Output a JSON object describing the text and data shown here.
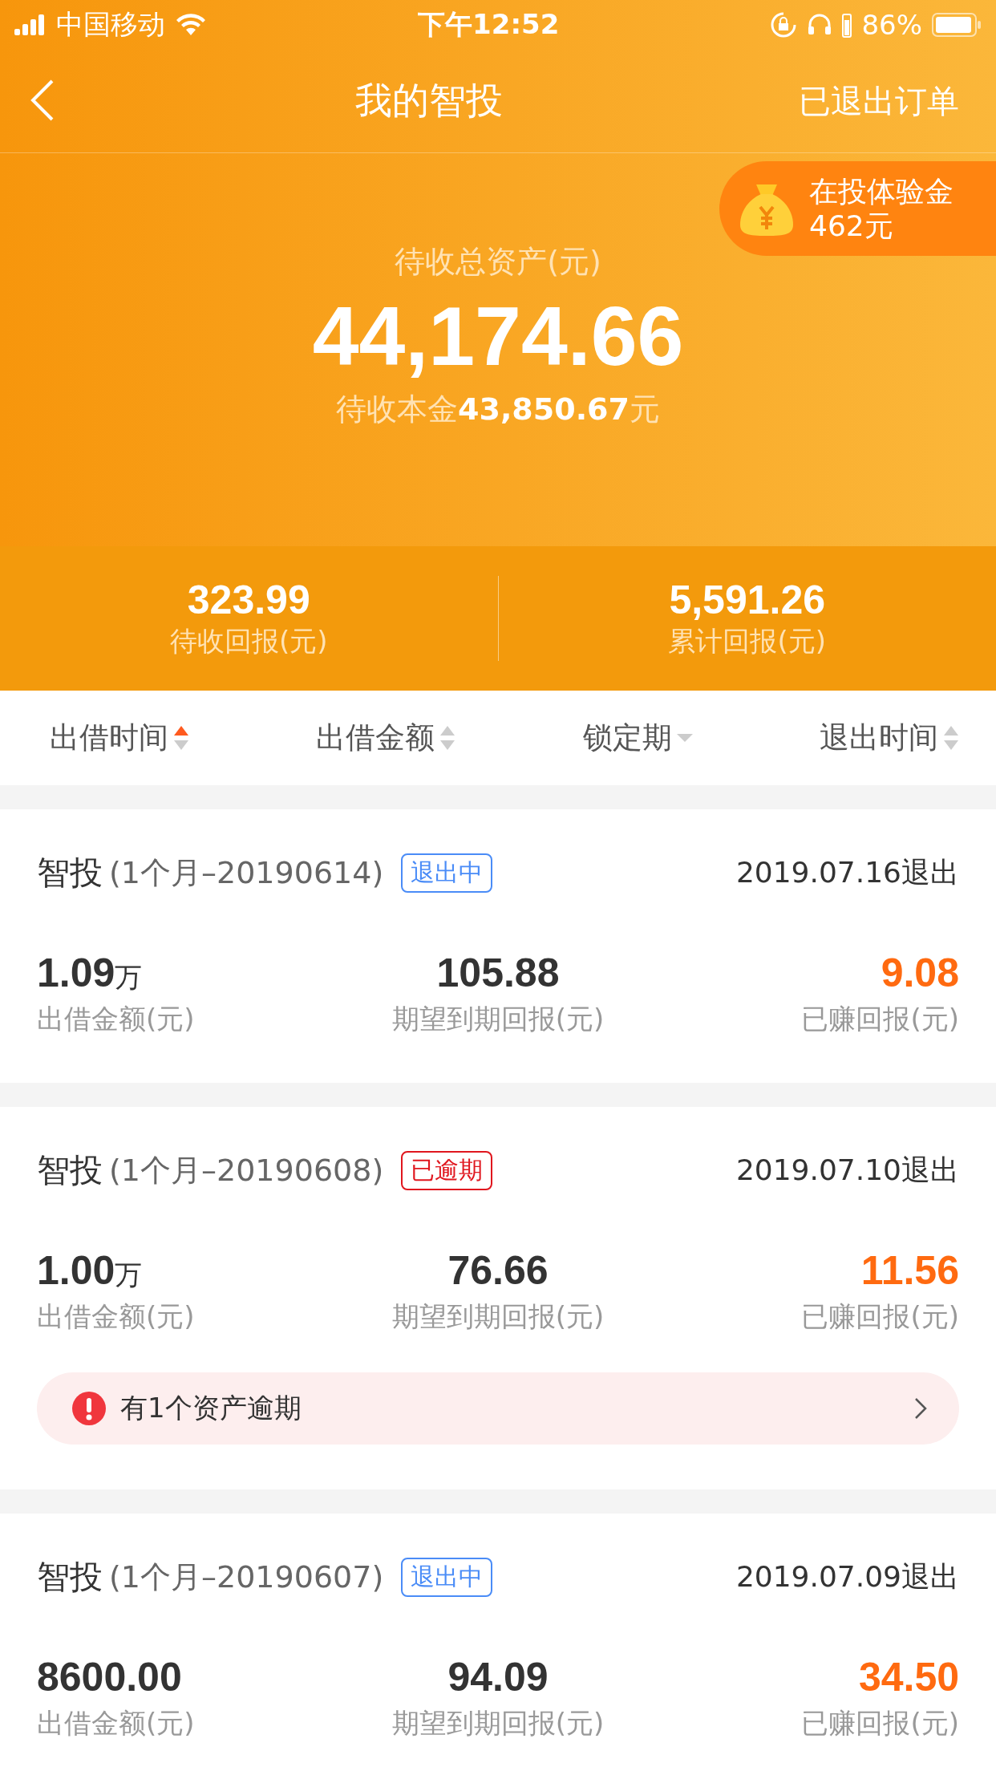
{
  "status_bar": {
    "carrier": "中国移动",
    "time": "下午12:52",
    "battery": "86%"
  },
  "nav": {
    "title": "我的智投",
    "action": "已退出订单"
  },
  "badge": {
    "label": "在投体验金",
    "amount": "462元"
  },
  "summary": {
    "label": "待收总资产(元)",
    "total": "44,174.66",
    "principal_label": "待收本金",
    "principal_value": "43,850.67",
    "principal_unit": "元"
  },
  "stats": [
    {
      "value": "323.99",
      "label": "待收回报(元)"
    },
    {
      "value": "5,591.26",
      "label": "累计回报(元)"
    }
  ],
  "sort_bar": [
    {
      "label": "出借时间",
      "kind": "both",
      "selected": true
    },
    {
      "label": "出借金额",
      "kind": "both",
      "selected": false
    },
    {
      "label": "锁定期",
      "kind": "down",
      "selected": false
    },
    {
      "label": "退出时间",
      "kind": "both",
      "selected": false
    }
  ],
  "orders": [
    {
      "name": "智投",
      "term": "(1个月–20190614)",
      "tag": "退出中",
      "kind": "exiting",
      "exit": "2019.07.16退出",
      "amount": "1.09",
      "amount_unit": "万",
      "amount_label": "出借金额(元)",
      "expected": "105.88",
      "expected_label": "期望到期回报(元)",
      "earned": "9.08",
      "earned_label": "已赚回报(元)"
    },
    {
      "name": "智投",
      "term": "(1个月–20190608)",
      "tag": "已逾期",
      "kind": "overdue",
      "exit": "2019.07.10退出",
      "amount": "1.00",
      "amount_unit": "万",
      "amount_label": "出借金额(元)",
      "expected": "76.66",
      "expected_label": "期望到期回报(元)",
      "earned": "11.56",
      "earned_label": "已赚回报(元)",
      "alert": "有1个资产逾期"
    },
    {
      "name": "智投",
      "term": "(1个月–20190607)",
      "tag": "退出中",
      "kind": "exiting",
      "exit": "2019.07.09退出",
      "amount": "8600.00",
      "amount_label": "出借金额(元)",
      "expected": "94.09",
      "expected_label": "期望到期回报(元)",
      "earned": "34.50",
      "earned_label": "已赚回报(元)"
    }
  ]
}
